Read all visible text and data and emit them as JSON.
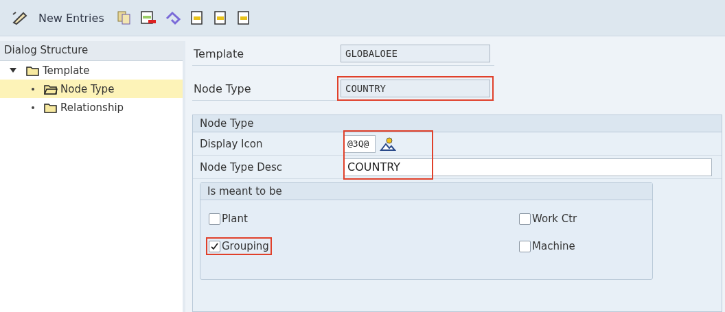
{
  "toolbar": {
    "label": "New Entries"
  },
  "dialog_structure": {
    "title": "Dialog Structure",
    "items": [
      {
        "label": "Template",
        "expanded": true,
        "selected": false,
        "children": [
          {
            "label": "Node Type",
            "selected": true,
            "open": true
          },
          {
            "label": "Relationship",
            "selected": false,
            "open": false
          }
        ]
      }
    ]
  },
  "header_fields": [
    {
      "label": "Template",
      "value": "GLOBALOEE",
      "highlighted": false
    },
    {
      "label": "Node Type",
      "value": "COUNTRY",
      "highlighted": true
    }
  ],
  "node_type_section": {
    "title": "Node Type",
    "highlighted": true,
    "display_icon": {
      "label": "Display Icon",
      "value": "@3Q@"
    },
    "description": {
      "label": "Node Type Desc",
      "value": "COUNTRY"
    }
  },
  "is_meant_to_be": {
    "title": "Is meant to be",
    "options": [
      {
        "label": "Plant",
        "checked": false,
        "highlighted": false
      },
      {
        "label": "Work Ctr",
        "checked": false,
        "highlighted": false
      },
      {
        "label": "Grouping",
        "checked": true,
        "highlighted": true
      },
      {
        "label": "Machine",
        "checked": false,
        "highlighted": false
      }
    ]
  }
}
